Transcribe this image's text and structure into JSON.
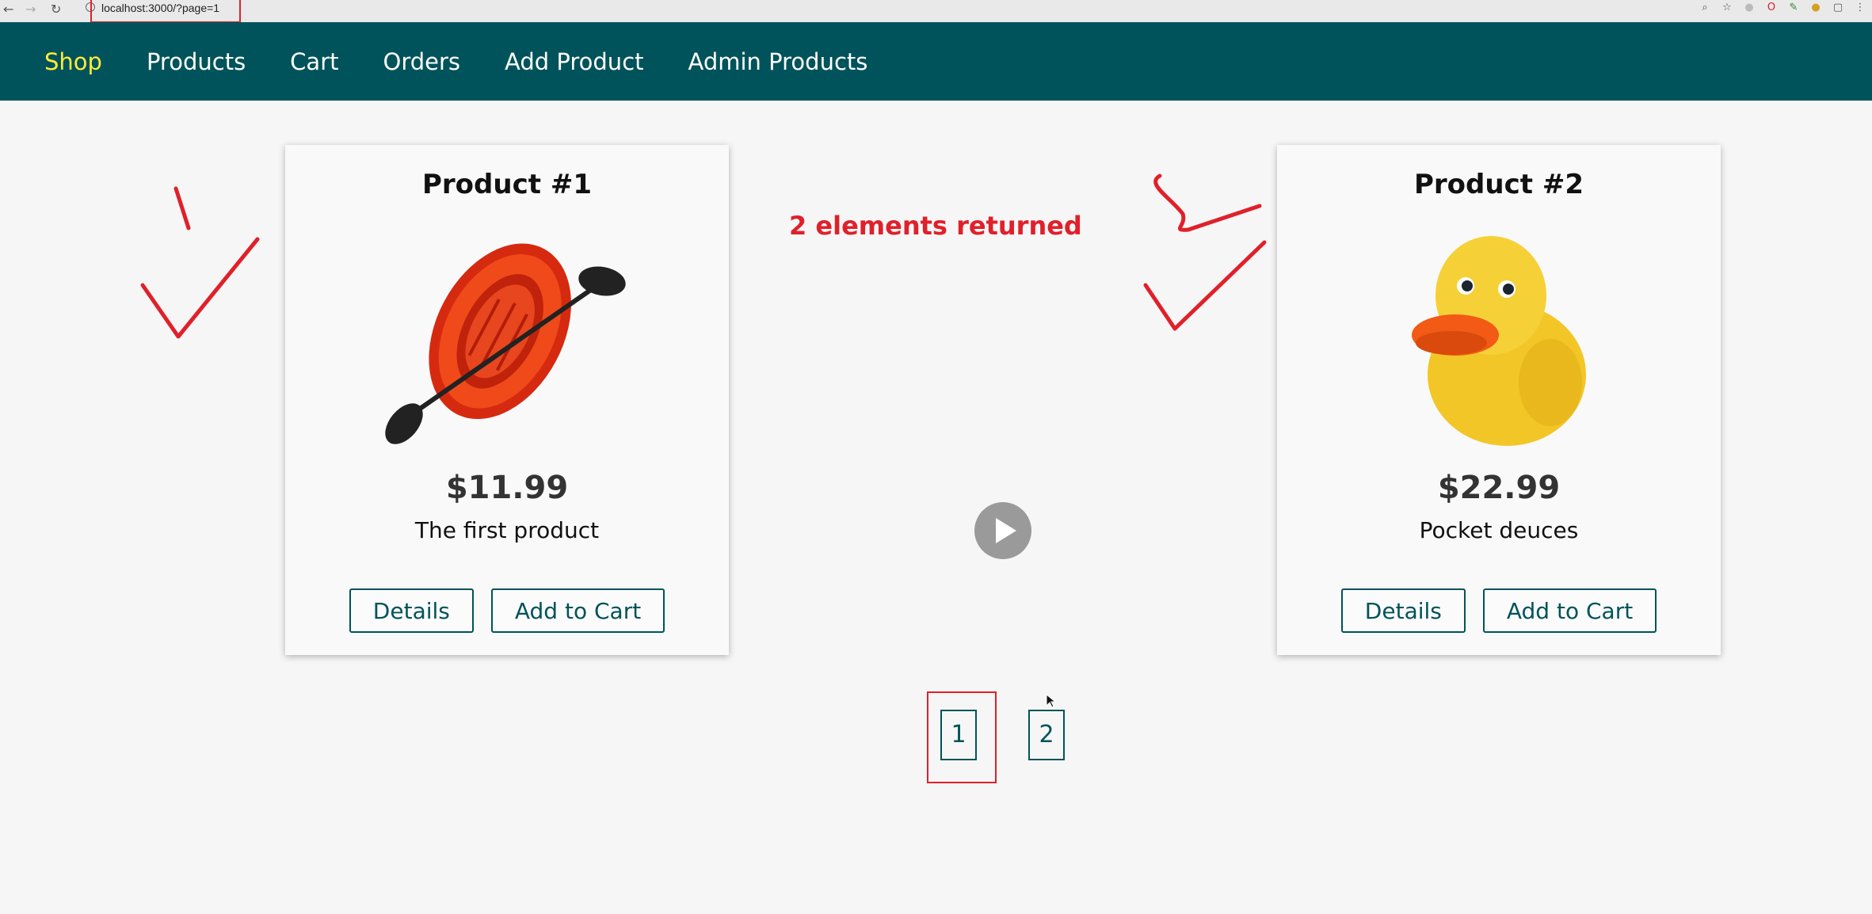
{
  "browser": {
    "url": "localhost:3000/?page=1"
  },
  "header": {
    "nav": [
      {
        "label": "Shop",
        "active": true
      },
      {
        "label": "Products"
      },
      {
        "label": "Cart"
      },
      {
        "label": "Orders"
      },
      {
        "label": "Add Product"
      },
      {
        "label": "Admin Products"
      }
    ]
  },
  "products": [
    {
      "title": "Product #1",
      "price": "$11.99",
      "description": "The first product",
      "details_label": "Details",
      "add_to_cart_label": "Add to Cart",
      "image": "inflatable-boat-image"
    },
    {
      "title": "Product #2",
      "price": "$22.99",
      "description": "Pocket deuces",
      "details_label": "Details",
      "add_to_cart_label": "Add to Cart",
      "image": "rubber-duck-image"
    }
  ],
  "annotation": {
    "text": "2 elements returned",
    "color": "#e0202a"
  },
  "pagination": {
    "pages": [
      "1",
      "2"
    ],
    "current": "1"
  },
  "colors": {
    "header_bg": "#00535a",
    "active_nav": "#ffeb3b",
    "accent": "#00535a"
  }
}
